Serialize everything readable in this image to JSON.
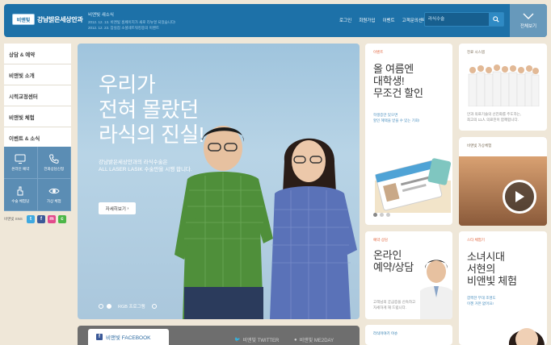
{
  "header": {
    "logo_mark": "비앤빛",
    "logo_name": "강남밝은세상안과",
    "news_title": "비앤빛 새소식",
    "news": [
      "2012. 12. 13.  비앤빛 홈페이지가 새로 리뉴얼 되었습니다!",
      "2012. 12. 23.  잠실점 소셜네트워킹중의 이벤트"
    ],
    "links": [
      "로그인",
      "회원가입",
      "이벤트",
      "고객문의센터"
    ],
    "search_placeholder": "라식수술",
    "viewall_label": "전체보기"
  },
  "nav": {
    "items": [
      "상담 & 예약",
      "비앤빛 소개",
      "시력교정센터",
      "비앤빛 체험",
      "이벤트 & 소식"
    ],
    "quick": [
      "온라인 예약",
      "전화상담신청",
      "수술 체험담",
      "가상 체험"
    ],
    "sns_label": "비앤빛 SNS"
  },
  "hero": {
    "headline": [
      "우리가",
      "전혀 몰랐던",
      "라식의 진실!"
    ],
    "sub": [
      "강남밝은세상안과의 라식수술은",
      "ALL LASER LASIK 수술만을 시행 합니다."
    ],
    "button_label": "자세히보기",
    "caption": "RGB 프로그램"
  },
  "social": {
    "facebook": "비앤빛 FACEBOOK",
    "twitter": "비앤빛 TWITTER",
    "me2day": "비앤빛 ME2DAY"
  },
  "cards": {
    "event": {
      "tag": "이벤트",
      "title": [
        "올 여름엔",
        "대학생!",
        "무조건 할인"
      ],
      "desc": [
        "학생증만 있으면",
        "할인 혜택을 받을 수 있는 기회!"
      ]
    },
    "staff": {
      "tag": "진료 시스템",
      "desc": [
        "안과 의료기술의 선진화를 주도하는,",
        "최고의 11人 의료진이 함께합니다."
      ]
    },
    "virtual": {
      "tag": "비앤빛 가상체험"
    },
    "consult": {
      "tag": "예약·상담",
      "title": [
        "온라인",
        "예약/상담"
      ],
      "desc": [
        "고객님의 궁금증을 신속하고",
        "자세하게 해 드립니다."
      ]
    },
    "story": {
      "tag": "스타 체험기",
      "title": [
        "소녀시대",
        "서현의",
        "비앤빛 체험"
      ],
      "desc": [
        "깜찍한 무대 조명도",
        "이젠 거뜬 없어요!"
      ]
    },
    "issue": {
      "tag": "라식이야기 이슈"
    }
  }
}
